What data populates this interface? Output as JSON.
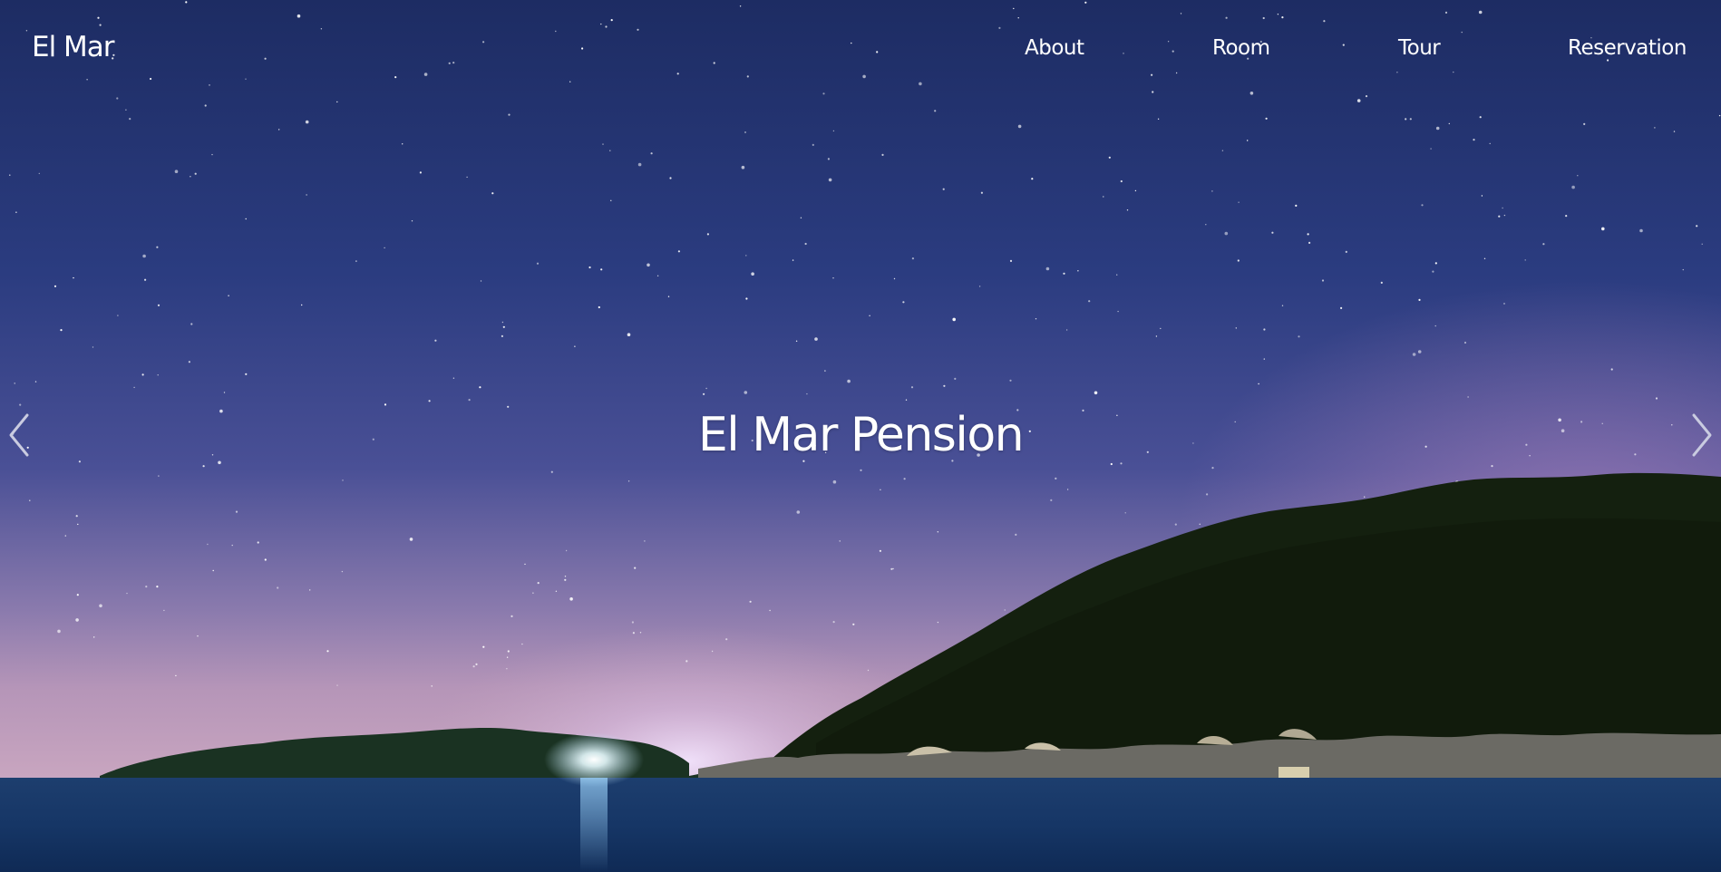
{
  "brand": {
    "name": "El Mar"
  },
  "nav": {
    "items": [
      {
        "label": "About"
      },
      {
        "label": "Room"
      },
      {
        "label": "Tour"
      },
      {
        "label": "Reservation"
      }
    ]
  },
  "hero": {
    "title": "El Mar Pension",
    "background_image": "night-sky-stars-over-sea-and-forested-hill",
    "prev_icon": "chevron-left-icon",
    "next_icon": "chevron-right-icon"
  },
  "colors": {
    "text": "#ffffff",
    "sky_top": "#1f2f66",
    "sky_horizon": "#c9a3c6",
    "sea": "#143260",
    "hill": "#15200f"
  }
}
